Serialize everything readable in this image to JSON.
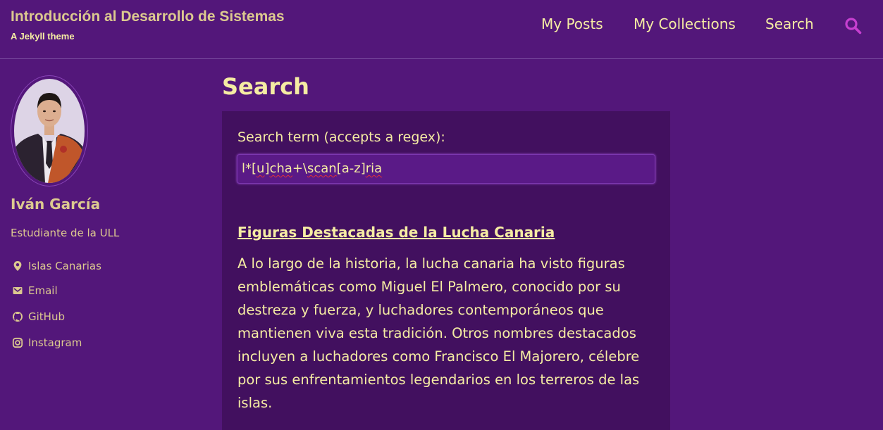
{
  "header": {
    "site_title": "Introducción al Desarrollo de Sistemas",
    "site_subtitle": "A Jekyll theme",
    "nav": [
      {
        "label": "My Posts"
      },
      {
        "label": "My Collections"
      },
      {
        "label": "Search"
      }
    ],
    "search_icon": "search-icon"
  },
  "sidebar": {
    "author_name": "Iván García",
    "author_bio": "Estudiante de la ULL",
    "links": [
      {
        "icon": "map-marker-icon",
        "label": "Islas Canarias"
      },
      {
        "icon": "envelope-icon",
        "label": "Email"
      },
      {
        "icon": "github-icon",
        "label": "GitHub"
      },
      {
        "icon": "instagram-icon",
        "label": "Instagram"
      }
    ]
  },
  "main": {
    "page_title": "Search",
    "search": {
      "label": "Search term (accepts a regex):",
      "value_parts": [
        "l*[",
        "u",
        "]",
        "cha",
        "+\\",
        "scan",
        "[a-z]",
        "ria"
      ]
    },
    "results": [
      {
        "title": "Figuras Destacadas de la Lucha Canaria",
        "excerpt": "A lo largo de la historia, la lucha canaria ha visto figuras emblemáticas como Miguel El Palmero, conocido por su destreza y fuerza, y luchadores contemporáneos que mantienen viva esta tradición. Otros nombres destacados incluyen a luchadores como Francisco El Majorero, célebre por sus enfrentamientos legendarios en los terreros de las islas."
      }
    ]
  },
  "colors": {
    "background": "#53177a",
    "panel": "#42105f",
    "text": "#f5eca3",
    "muted_text": "#dcc98f",
    "accent_icon": "#c63fd0"
  }
}
